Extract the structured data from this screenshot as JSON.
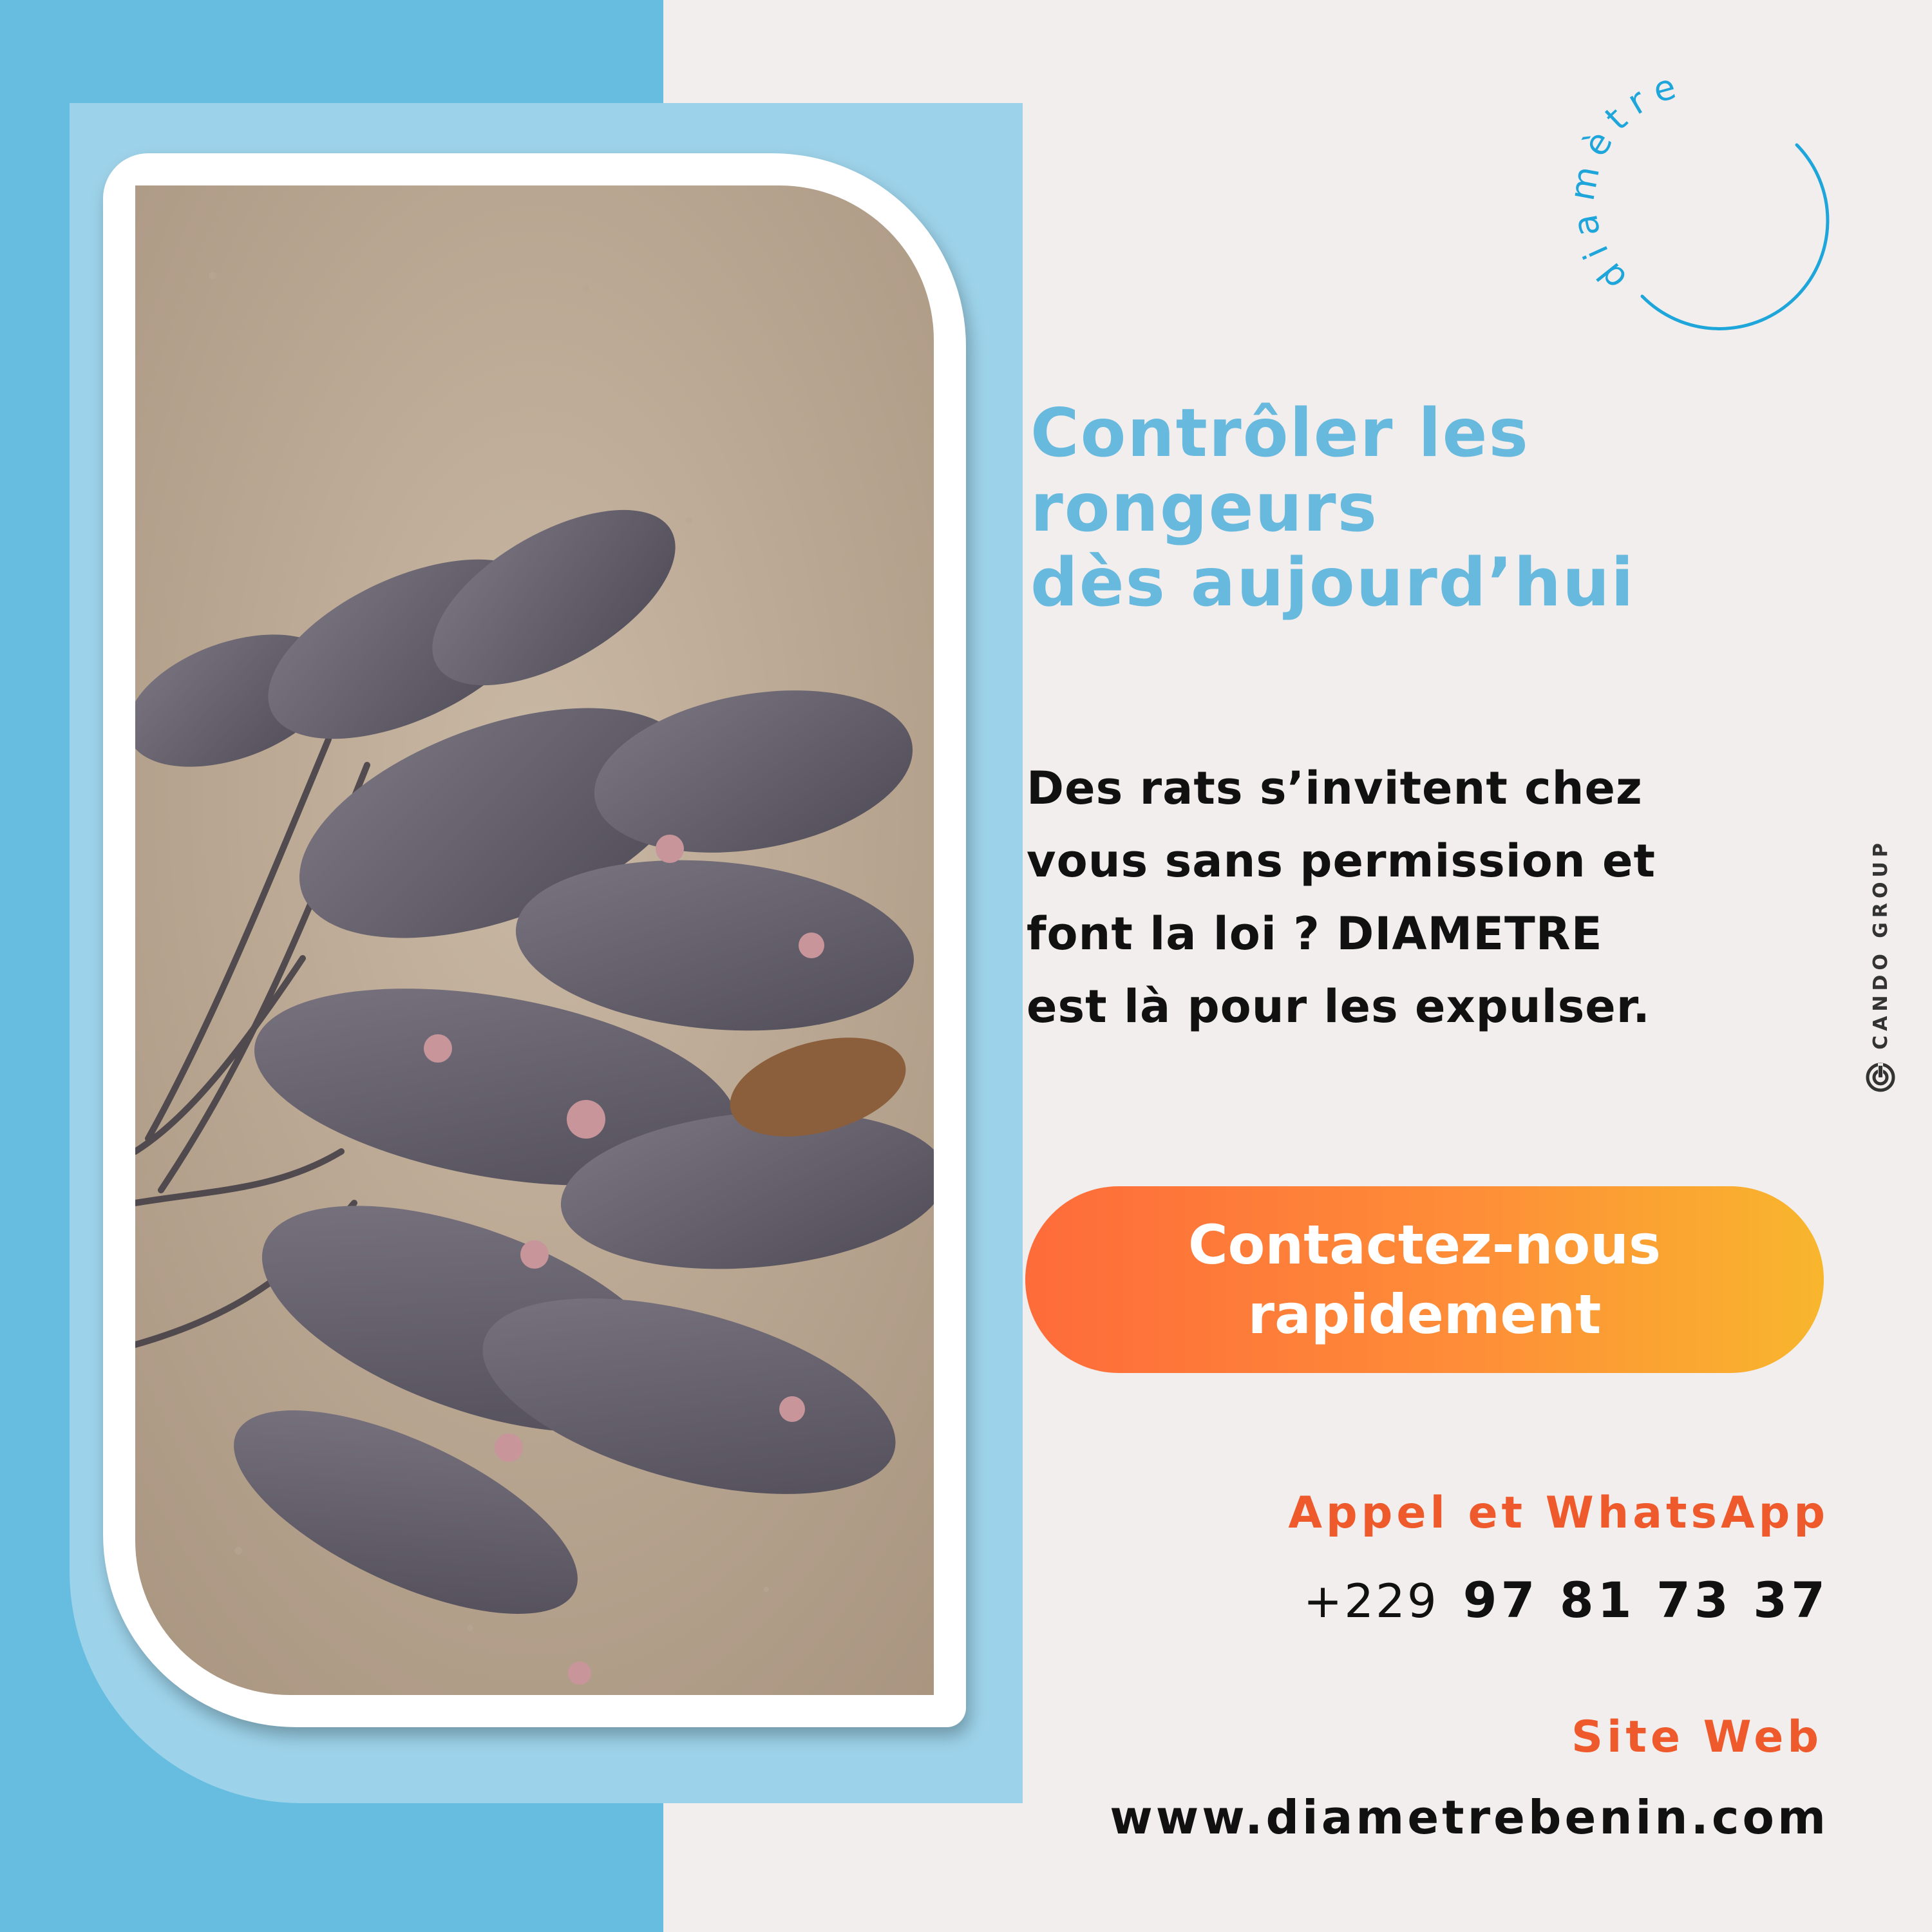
{
  "logo": {
    "text": "diamètre",
    "icon": "diametre-circle-logo",
    "color": "#1ea6db"
  },
  "photo": {
    "icon": "rats-photo"
  },
  "headline": {
    "line1": "Contrôler les",
    "line2": "rongeurs",
    "line3": "dès aujourd’hui",
    "color": "#67b9de"
  },
  "body": {
    "line1": "Des rats s’invitent chez",
    "line2": "vous sans permission et",
    "line3": "font la loi ? DIAMETRE",
    "line4": "est là pour les expulser."
  },
  "cta": {
    "line1": "Contactez-nous",
    "line2": "rapidement",
    "gradient_start": "#fe6b3a",
    "gradient_end": "#f8b62d"
  },
  "brand": {
    "text": "CANDO GROUP",
    "icon": "cando-logo-icon"
  },
  "contact": {
    "label": "Appel et WhatsApp",
    "country_code": "+229",
    "number": "97 81 73 37"
  },
  "website": {
    "label": "Site Web",
    "url": "www.diametrebenin.com"
  },
  "colors": {
    "accent_blue": "#67bde0",
    "accent_orange": "#ef5a2c",
    "background": "#f2eeed"
  }
}
